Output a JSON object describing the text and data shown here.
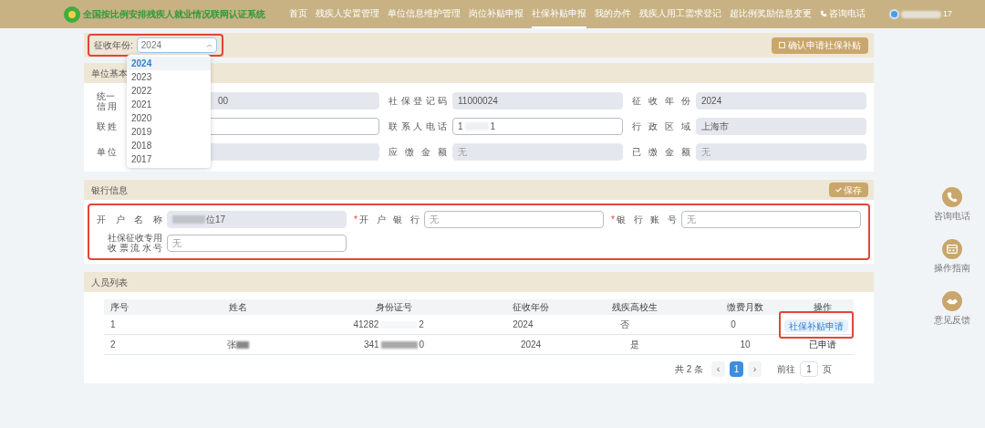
{
  "header": {
    "title": "全国按比例安排残疾人就业情况联网认证系统",
    "nav": [
      {
        "label": "首页",
        "selected": false
      },
      {
        "label": "残疾人安置管理",
        "selected": false
      },
      {
        "label": "单位信息维护管理",
        "selected": false
      },
      {
        "label": "岗位补贴申报",
        "selected": false
      },
      {
        "label": "社保补贴申报",
        "selected": true
      },
      {
        "label": "我的办件",
        "selected": false
      },
      {
        "label": "残疾人用工需求登记",
        "selected": false
      },
      {
        "label": "超比例奖励信息变更",
        "selected": false
      },
      {
        "label": "咨询电话",
        "selected": false,
        "kind": "phone"
      }
    ],
    "user": "17"
  },
  "year_filter": {
    "label": "征收年份:",
    "value": "2024",
    "expanded": true,
    "options": [
      {
        "label": "2024",
        "selected": true
      },
      {
        "label": "2023",
        "selected": false
      },
      {
        "label": "2022",
        "selected": false
      },
      {
        "label": "2021",
        "selected": false
      },
      {
        "label": "2020",
        "selected": false
      },
      {
        "label": "2019",
        "selected": false
      },
      {
        "label": "2018",
        "selected": false
      },
      {
        "label": "2017",
        "selected": false
      }
    ],
    "button": "确认申请社保补贴"
  },
  "unit_info": {
    "title": "单位基本",
    "fields": [
      {
        "label": "统一信用",
        "value": "00",
        "readonly": true
      },
      {
        "label": "社保登记码",
        "value": "11000024",
        "readonly": true
      },
      {
        "label": "征收年份",
        "value": "2024",
        "readonly": true
      },
      {
        "label": "联姓",
        "readonly": false
      },
      {
        "label": "联系人电话",
        "value": "1",
        "value_end": "1",
        "readonly": false
      },
      {
        "label": "行政区域",
        "value": "上海市",
        "readonly": true
      },
      {
        "label": "单位",
        "readonly": true
      },
      {
        "label": "应缴金额",
        "placeholder": "无",
        "readonly": true
      },
      {
        "label": "已缴金额",
        "placeholder": "无",
        "readonly": true
      }
    ]
  },
  "bank_info": {
    "title": "银行信息",
    "button": "保存",
    "required_mark": "*",
    "fields": [
      {
        "label": "开户名称",
        "value": "位17",
        "redacted": true,
        "readonly": true,
        "required": false
      },
      {
        "label": "开户银行",
        "placeholder": "无",
        "readonly": false,
        "required": true
      },
      {
        "label": "银行账号",
        "placeholder": "无",
        "readonly": false,
        "required": true
      },
      {
        "label": "社保征收专用收票流水号",
        "placeholder": "无",
        "readonly": false,
        "required": false
      }
    ]
  },
  "people": {
    "title": "人员列表",
    "columns": [
      "序号",
      "姓名",
      "身份证号",
      "征收年份",
      "残疾高校生",
      "缴费月数",
      "操作"
    ],
    "rows": [
      {
        "cells": [
          "1",
          "",
          "41282",
          "2024",
          "否",
          "0"
        ],
        "id_end": "2",
        "name_redacted": false,
        "action": {
          "kind": "button",
          "label": "社保补贴申请"
        }
      },
      {
        "cells": [
          "2",
          "张",
          "341",
          "2024",
          "是",
          "10"
        ],
        "id_end": "0",
        "name_redacted": true,
        "action": {
          "kind": "text",
          "label": "已申请"
        }
      }
    ],
    "pagination": {
      "total": "共 2 条",
      "prev": "‹",
      "pages": [
        {
          "label": "1",
          "selected": true
        }
      ],
      "next": "›",
      "goto_label": "前往",
      "goto_value": "1",
      "goto_unit": "页"
    }
  },
  "side_tools": [
    {
      "kind": "phone",
      "label": "咨询电话"
    },
    {
      "kind": "guide",
      "label": "操作指南"
    },
    {
      "kind": "help",
      "label": "意见反馈"
    }
  ]
}
